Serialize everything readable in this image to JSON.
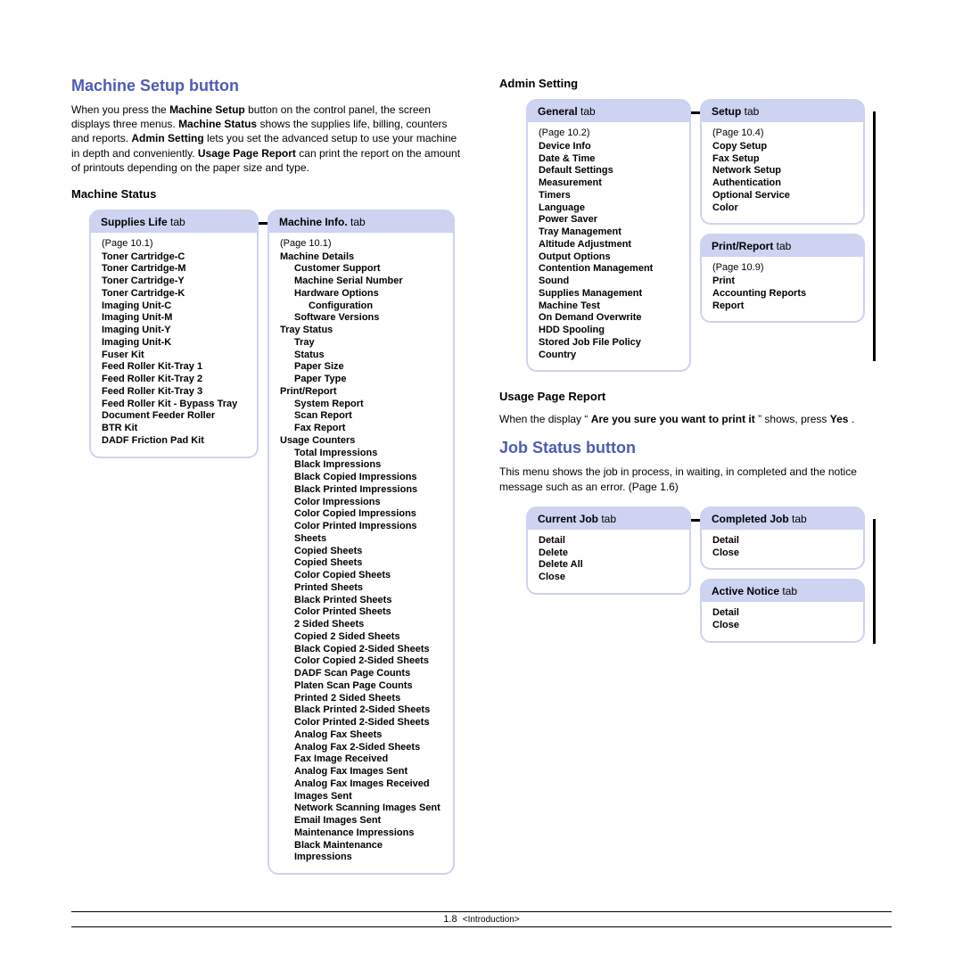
{
  "left": {
    "heading": "Machine Setup button",
    "intro_parts": {
      "p1": "When you press the ",
      "b1": "Machine Setup",
      "p2": " button on the control panel, the screen displays three menus. ",
      "b2": "Machine Status",
      "p3": " shows the supplies life, billing, counters and reports. ",
      "b3": "Admin Setting",
      "p4": " lets you set the advanced setup to use your machine in depth and conveniently. ",
      "b4": "Usage Page Report",
      "p5": " can print the report on the amount of printouts depending on the paper size and type."
    },
    "machine_status_heading": "Machine Status",
    "supplies_tab": {
      "title_bold": "Supplies Life",
      "title_light": " tab",
      "page_ref": "(Page 10.1)",
      "items": [
        "Toner Cartridge-C",
        "Toner Cartridge-M",
        "Toner Cartridge-Y",
        "Toner Cartridge-K",
        "Imaging Unit-C",
        "Imaging Unit-M",
        "Imaging Unit-Y",
        "Imaging Unit-K",
        "Fuser Kit",
        "Feed Roller Kit-Tray 1",
        "Feed Roller Kit-Tray 2",
        "Feed Roller Kit-Tray 3",
        "Feed Roller Kit - Bypass Tray",
        "Document Feeder Roller",
        "BTR Kit",
        "DADF Friction Pad Kit"
      ]
    },
    "machine_info_tab": {
      "title_bold": "Machine Info.",
      "title_light": " tab",
      "page_ref": "(Page 10.1)",
      "lines": [
        {
          "t": "Machine Details",
          "i": 0
        },
        {
          "t": "Customer Support",
          "i": 1
        },
        {
          "t": "Machine Serial Number",
          "i": 1
        },
        {
          "t": "Hardware Options",
          "i": 1
        },
        {
          "t": "Configuration",
          "i": 2
        },
        {
          "t": "Software Versions",
          "i": 1
        },
        {
          "t": "Tray Status",
          "i": 0
        },
        {
          "t": "Tray",
          "i": 1
        },
        {
          "t": "Status",
          "i": 1
        },
        {
          "t": "Paper Size",
          "i": 1
        },
        {
          "t": "Paper Type",
          "i": 1
        },
        {
          "t": "Print/Report",
          "i": 0
        },
        {
          "t": "System Report",
          "i": 1
        },
        {
          "t": "Scan Report",
          "i": 1
        },
        {
          "t": "Fax Report",
          "i": 1
        },
        {
          "t": "Usage Counters",
          "i": 0
        },
        {
          "t": "Total Impressions",
          "i": 1
        },
        {
          "t": "Black Impressions",
          "i": 1
        },
        {
          "t": "Black Copied Impressions",
          "i": 1
        },
        {
          "t": "Black Printed Impressions",
          "i": 1
        },
        {
          "t": "Color Impressions",
          "i": 1
        },
        {
          "t": "Color Copied Impressions",
          "i": 1
        },
        {
          "t": "Color Printed Impressions",
          "i": 1
        },
        {
          "t": "Sheets",
          "i": 1
        },
        {
          "t": "Copied Sheets",
          "i": 1
        },
        {
          "t": "Copied Sheets",
          "i": 1
        },
        {
          "t": "Color Copied Sheets",
          "i": 1
        },
        {
          "t": "Printed Sheets",
          "i": 1
        },
        {
          "t": "Black Printed Sheets",
          "i": 1
        },
        {
          "t": "Color Printed Sheets",
          "i": 1
        },
        {
          "t": "2 Sided Sheets",
          "i": 1
        },
        {
          "t": "Copied 2 Sided Sheets",
          "i": 1
        },
        {
          "t": "Black Copied 2-Sided Sheets",
          "i": 1
        },
        {
          "t": "Color Copied 2-Sided Sheets",
          "i": 1
        },
        {
          "t": "DADF Scan Page Counts",
          "i": 1
        },
        {
          "t": "Platen Scan Page Counts",
          "i": 1
        },
        {
          "t": "Printed 2 Sided Sheets",
          "i": 1
        },
        {
          "t": "Black Printed 2-Sided Sheets",
          "i": 1
        },
        {
          "t": "Color Printed 2-Sided Sheets",
          "i": 1
        },
        {
          "t": "Analog Fax Sheets",
          "i": 1
        },
        {
          "t": "Analog Fax 2-Sided Sheets",
          "i": 1
        },
        {
          "t": "Fax Image Received",
          "i": 1
        },
        {
          "t": "Analog Fax Images Sent",
          "i": 1
        },
        {
          "t": "Analog Fax Images Received",
          "i": 1
        },
        {
          "t": "Images Sent",
          "i": 1
        },
        {
          "t": "Network Scanning Images Sent",
          "i": 1
        },
        {
          "t": "Email Images Sent",
          "i": 1
        },
        {
          "t": "Maintenance Impressions",
          "i": 1
        },
        {
          "t": "Black Maintenance Impressions",
          "i": 1
        }
      ]
    }
  },
  "right": {
    "admin_heading": "Admin Setting",
    "general_tab": {
      "title_bold": "General",
      "title_light": " tab",
      "page_ref": "(Page 10.2)",
      "items": [
        "Device Info",
        "Date & Time",
        "Default Settings",
        "Measurement",
        "Timers",
        "Language",
        "Power Saver",
        "Tray Management",
        "Altitude Adjustment",
        "Output Options",
        "Contention Management",
        "Sound",
        "Supplies Management",
        "Machine Test",
        "On Demand Overwrite",
        "HDD Spooling",
        "Stored Job File Policy",
        "Country"
      ]
    },
    "setup_tab": {
      "title_bold": "Setup",
      "title_light": " tab",
      "page_ref": "(Page 10.4)",
      "items": [
        "Copy Setup",
        "Fax Setup",
        "Network Setup",
        "Authentication",
        "Optional Service",
        "Color"
      ]
    },
    "print_report_tab": {
      "title_bold": "Print/Report",
      "title_light": " tab",
      "page_ref": "(Page 10.9)",
      "items": [
        "Print",
        "Accounting Reports",
        "Report"
      ]
    },
    "usage_page_heading": "Usage Page Report",
    "usage_parts": {
      "p1": "When the display  “ ",
      "b1": "Are you sure you want to print it",
      "p2": "” shows, press ",
      "b2": "Yes",
      "p3": "."
    },
    "job_status_heading": "Job Status button",
    "job_intro": "This menu shows the job in process, in waiting, in completed and the notice message such as an error. (Page 1.6)",
    "current_job_tab": {
      "title_bold": "Current Job",
      "title_light": " tab",
      "items": [
        "Detail",
        "Delete",
        "Delete All",
        "Close"
      ]
    },
    "completed_job_tab": {
      "title_bold": "Completed Job",
      "title_light": " tab",
      "items": [
        "Detail",
        "Close"
      ]
    },
    "active_notice_tab": {
      "title_bold": "Active Notice",
      "title_light": " tab",
      "items": [
        "Detail",
        "Close"
      ]
    }
  },
  "footer": {
    "page_num": "1.8",
    "section": "<Introduction>"
  }
}
